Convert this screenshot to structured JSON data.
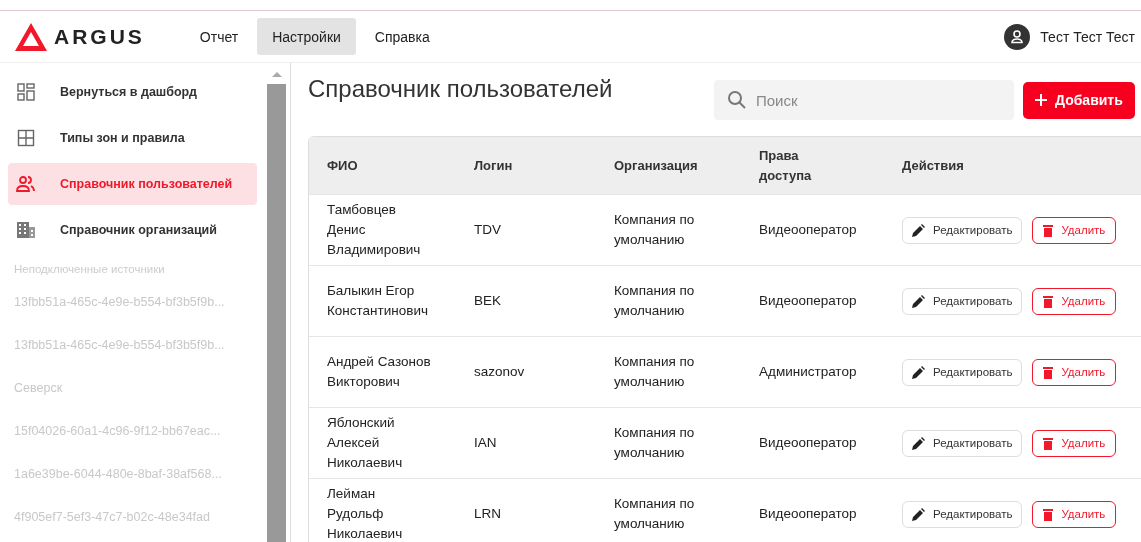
{
  "header": {
    "logo": "ARGUS",
    "nav": [
      {
        "label": "Отчет",
        "selected": false
      },
      {
        "label": "Настройки",
        "selected": true
      },
      {
        "label": "Справка",
        "selected": false
      }
    ],
    "user": "Тест Тест Тест"
  },
  "sidebar": {
    "items": [
      {
        "label": "Вернуться в дашборд",
        "kind": "dashboard",
        "selected": false
      },
      {
        "label": "Типы зон и правила",
        "kind": "zones",
        "selected": false
      },
      {
        "label": "Справочник пользователей",
        "kind": "users",
        "selected": true
      },
      {
        "label": "Справочник организаций",
        "kind": "orgs",
        "selected": false
      }
    ],
    "sources_heading": "Неподключенные источники",
    "sources": [
      "13fbb51a-465c-4e9e-b554-bf3b5f9b...",
      "13fbb51a-465c-4e9e-b554-bf3b5f9b...",
      "Северск",
      "15f04026-60a1-4c96-9f12-bb67eac...",
      "1a6e39be-6044-480e-8baf-38af568...",
      "4f905ef7-5ef3-47c7-b02c-48e34fad"
    ]
  },
  "page": {
    "title": "Справочник пользователей",
    "search": {
      "placeholder": "Поиск"
    },
    "add_button": "Добавить"
  },
  "table": {
    "columns": [
      "ФИО",
      "Логин",
      "Организация",
      "Права доступа",
      "Действия"
    ],
    "rows": [
      {
        "name": "Тамбовцев Денис Владимирович",
        "login": "TDV",
        "organization": "Компания по умолчанию",
        "role": "Видеооператор",
        "edit": "Редактировать",
        "delete": "Удалить"
      },
      {
        "name": "Балыкин Егор Константинович",
        "login": "BEK",
        "organization": "Компания по умолчанию",
        "role": "Видеооператор",
        "edit": "Редактировать",
        "delete": "Удалить"
      },
      {
        "name": "Андрей Сазонов Викторович",
        "login": "sazonov",
        "organization": "Компания по умолчанию",
        "role": "Администратор",
        "edit": "Редактировать",
        "delete": "Удалить"
      },
      {
        "name": "Яблонский Алексей Николаевич",
        "login": "IAN",
        "organization": "Компания по умолчанию",
        "role": "Видеооператор",
        "edit": "Редактировать",
        "delete": "Удалить"
      },
      {
        "name": "Лейман Рудольф Николаевич",
        "login": "LRN",
        "organization": "Компания по умолчанию",
        "role": "Видеооператор",
        "edit": "Редактировать",
        "delete": "Удалить"
      }
    ]
  }
}
